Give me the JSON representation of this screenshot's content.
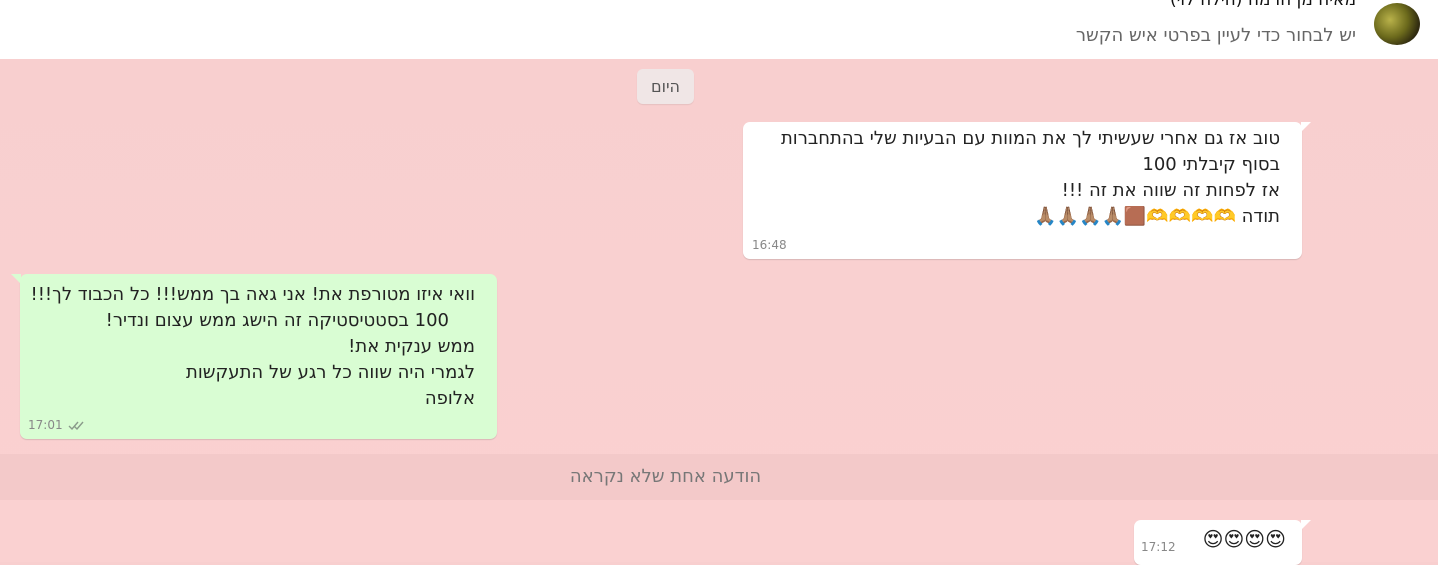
{
  "header": {
    "contact_name": "מאיה מן הרמה (הילה לוי)",
    "subtitle": "יש לבחור כדי לעיין בפרטי איש הקשר"
  },
  "date_chip": "היום",
  "messages": [
    {
      "direction": "outgoing",
      "lines": [
        "טוב אז גם אחרי שעשיתי לך את המוות עם הבעיות שלי בהתחברות",
        "בסוף קיבלתי 100",
        "אז לפחות זה שווה את זה !!!",
        "תודה 🫶🫶🫶🫶🟫🙏🏽🙏🏽🙏🏽🙏🏽"
      ],
      "time": "16:48"
    },
    {
      "direction": "incoming",
      "lines": [
        "וואי איזו מטורפת את! אני גאה בך ממש!!! כל הכבוד לך!!!",
        "100 בסטטיסטיקה זה הישג ממש עצום ונדיר!",
        "ממש ענקית את!",
        "לגמרי היה שווה כל רגע של התעקשות",
        "אלופה"
      ],
      "time": "17:01"
    },
    {
      "direction": "outgoing",
      "lines": [
        "😍😍😍😍"
      ],
      "time": "17:12"
    }
  ],
  "unread_notice": "הודעה אחת שלא נקראה",
  "colors": {
    "chat_background": "#f8cfcf",
    "incoming_bubble": "#d9fdd3",
    "outgoing_bubble": "#ffffff"
  }
}
